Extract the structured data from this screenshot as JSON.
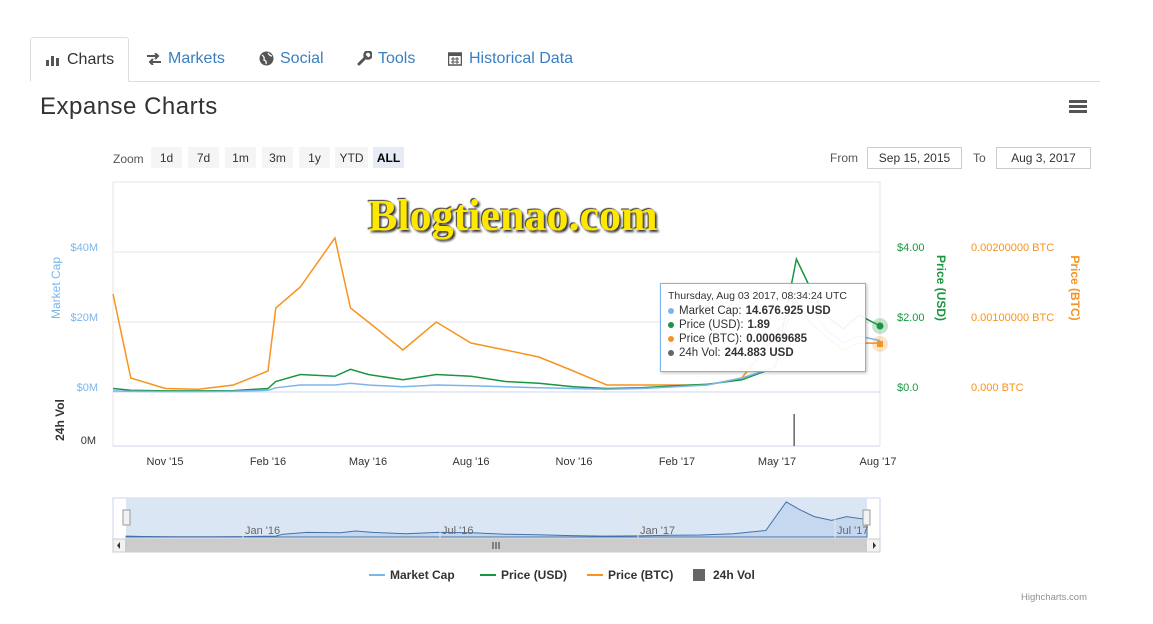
{
  "tabs": [
    {
      "label": "Charts",
      "icon": "bar-chart-icon"
    },
    {
      "label": "Markets",
      "icon": "exchange-icon"
    },
    {
      "label": "Social",
      "icon": "globe-icon"
    },
    {
      "label": "Tools",
      "icon": "wrench-icon"
    },
    {
      "label": "Historical Data",
      "icon": "calendar-icon"
    }
  ],
  "title": "Expanse Charts",
  "zoom": {
    "label": "Zoom",
    "buttons": [
      "1d",
      "7d",
      "1m",
      "3m",
      "1y",
      "YTD",
      "ALL"
    ],
    "selected": "ALL"
  },
  "range": {
    "from_label": "From",
    "from_value": "Sep 15, 2015",
    "to_label": "To",
    "to_value": "Aug 3, 2017"
  },
  "watermark": "Blogtienao.com",
  "axes": {
    "left_title": "Market Cap",
    "left_ticks": [
      "$40M",
      "$20M",
      "$0M"
    ],
    "usd_title": "Price (USD)",
    "usd_ticks": [
      "$4.00",
      "$2.00",
      "$0.0"
    ],
    "btc_title": "Price (BTC)",
    "btc_ticks": [
      "0.00200000 BTC",
      "0.00100000 BTC",
      "0.000 BTC"
    ],
    "vol_title": "24h Vol",
    "vol_tick": "0M",
    "x_ticks": [
      "Nov '15",
      "Feb '16",
      "May '16",
      "Aug '16",
      "Nov '16",
      "Feb '17",
      "May '17",
      "Aug '17"
    ],
    "nav_ticks": [
      "Jan '16",
      "Jul '16",
      "Jan '17",
      "Jul '17"
    ]
  },
  "tooltip": {
    "header": "Thursday, Aug 03 2017, 08:34:24 UTC",
    "rows": [
      {
        "label": "Market Cap:",
        "value": "14.676.925 USD",
        "color": "#7cb5ec"
      },
      {
        "label": "Price (USD):",
        "value": "1.89",
        "color": "#1a9641"
      },
      {
        "label": "Price (BTC):",
        "value": "0.00069685",
        "color": "#f7931e"
      },
      {
        "label": "24h Vol:",
        "value": "244.883 USD",
        "color": "#666666"
      }
    ]
  },
  "legend": [
    {
      "label": "Market Cap",
      "color": "#7cb5ec",
      "kind": "line"
    },
    {
      "label": "Price (USD)",
      "color": "#1a9641",
      "kind": "line"
    },
    {
      "label": "Price (BTC)",
      "color": "#f7931e",
      "kind": "line"
    },
    {
      "label": "24h Vol",
      "color": "#666666",
      "kind": "box"
    }
  ],
  "credits": "Highcharts.com",
  "chart_data": {
    "type": "line",
    "x": [
      "2015-09-15",
      "2015-10-01",
      "2015-11-01",
      "2015-12-01",
      "2016-01-01",
      "2016-02-01",
      "2016-02-08",
      "2016-03-01",
      "2016-04-01",
      "2016-04-15",
      "2016-05-01",
      "2016-06-01",
      "2016-07-01",
      "2016-08-01",
      "2016-09-01",
      "2016-10-01",
      "2016-11-01",
      "2016-12-01",
      "2017-01-01",
      "2017-02-01",
      "2017-03-01",
      "2017-04-01",
      "2017-05-01",
      "2017-05-20",
      "2017-06-01",
      "2017-06-15",
      "2017-07-01",
      "2017-07-15",
      "2017-08-03"
    ],
    "series": [
      {
        "name": "Price (USD)",
        "axis": "Price (USD)",
        "values": [
          0.1,
          0.05,
          0.03,
          0.03,
          0.04,
          0.1,
          0.3,
          0.5,
          0.45,
          0.65,
          0.5,
          0.35,
          0.5,
          0.45,
          0.3,
          0.25,
          0.15,
          0.1,
          0.12,
          0.18,
          0.22,
          0.35,
          0.7,
          3.8,
          3.0,
          2.2,
          1.8,
          2.2,
          1.89
        ]
      },
      {
        "name": "Price (BTC)",
        "axis": "Price (BTC)",
        "values": [
          0.0014,
          0.0002,
          5e-05,
          4e-05,
          0.0001,
          0.0003,
          0.0012,
          0.0015,
          0.0022,
          0.0012,
          0.001,
          0.0006,
          0.001,
          0.0007,
          0.0006,
          0.0005,
          0.0003,
          0.0001,
          0.0001,
          0.0001,
          0.0001,
          0.0002,
          0.0008,
          0.0013,
          0.001,
          0.0008,
          0.0006,
          0.0007,
          0.00069685
        ]
      },
      {
        "name": "Market Cap",
        "axis": "Market Cap",
        "values": [
          0.3,
          0.2,
          0.1,
          0.1,
          0.2,
          0.5,
          1.2,
          2.0,
          2.0,
          2.5,
          2.0,
          1.5,
          2.0,
          1.8,
          1.5,
          1.2,
          1.0,
          0.8,
          1.0,
          1.5,
          2.0,
          4.0,
          7.0,
          30.0,
          25.0,
          18.0,
          14.0,
          16.0,
          14.676925
        ]
      }
    ],
    "vol_spike": {
      "x": "2017-05-18",
      "label": "24h Vol"
    },
    "ylim_market_cap": [
      0,
      40
    ],
    "ylim_usd": [
      0,
      4
    ],
    "ylim_btc": [
      0,
      0.002
    ]
  }
}
